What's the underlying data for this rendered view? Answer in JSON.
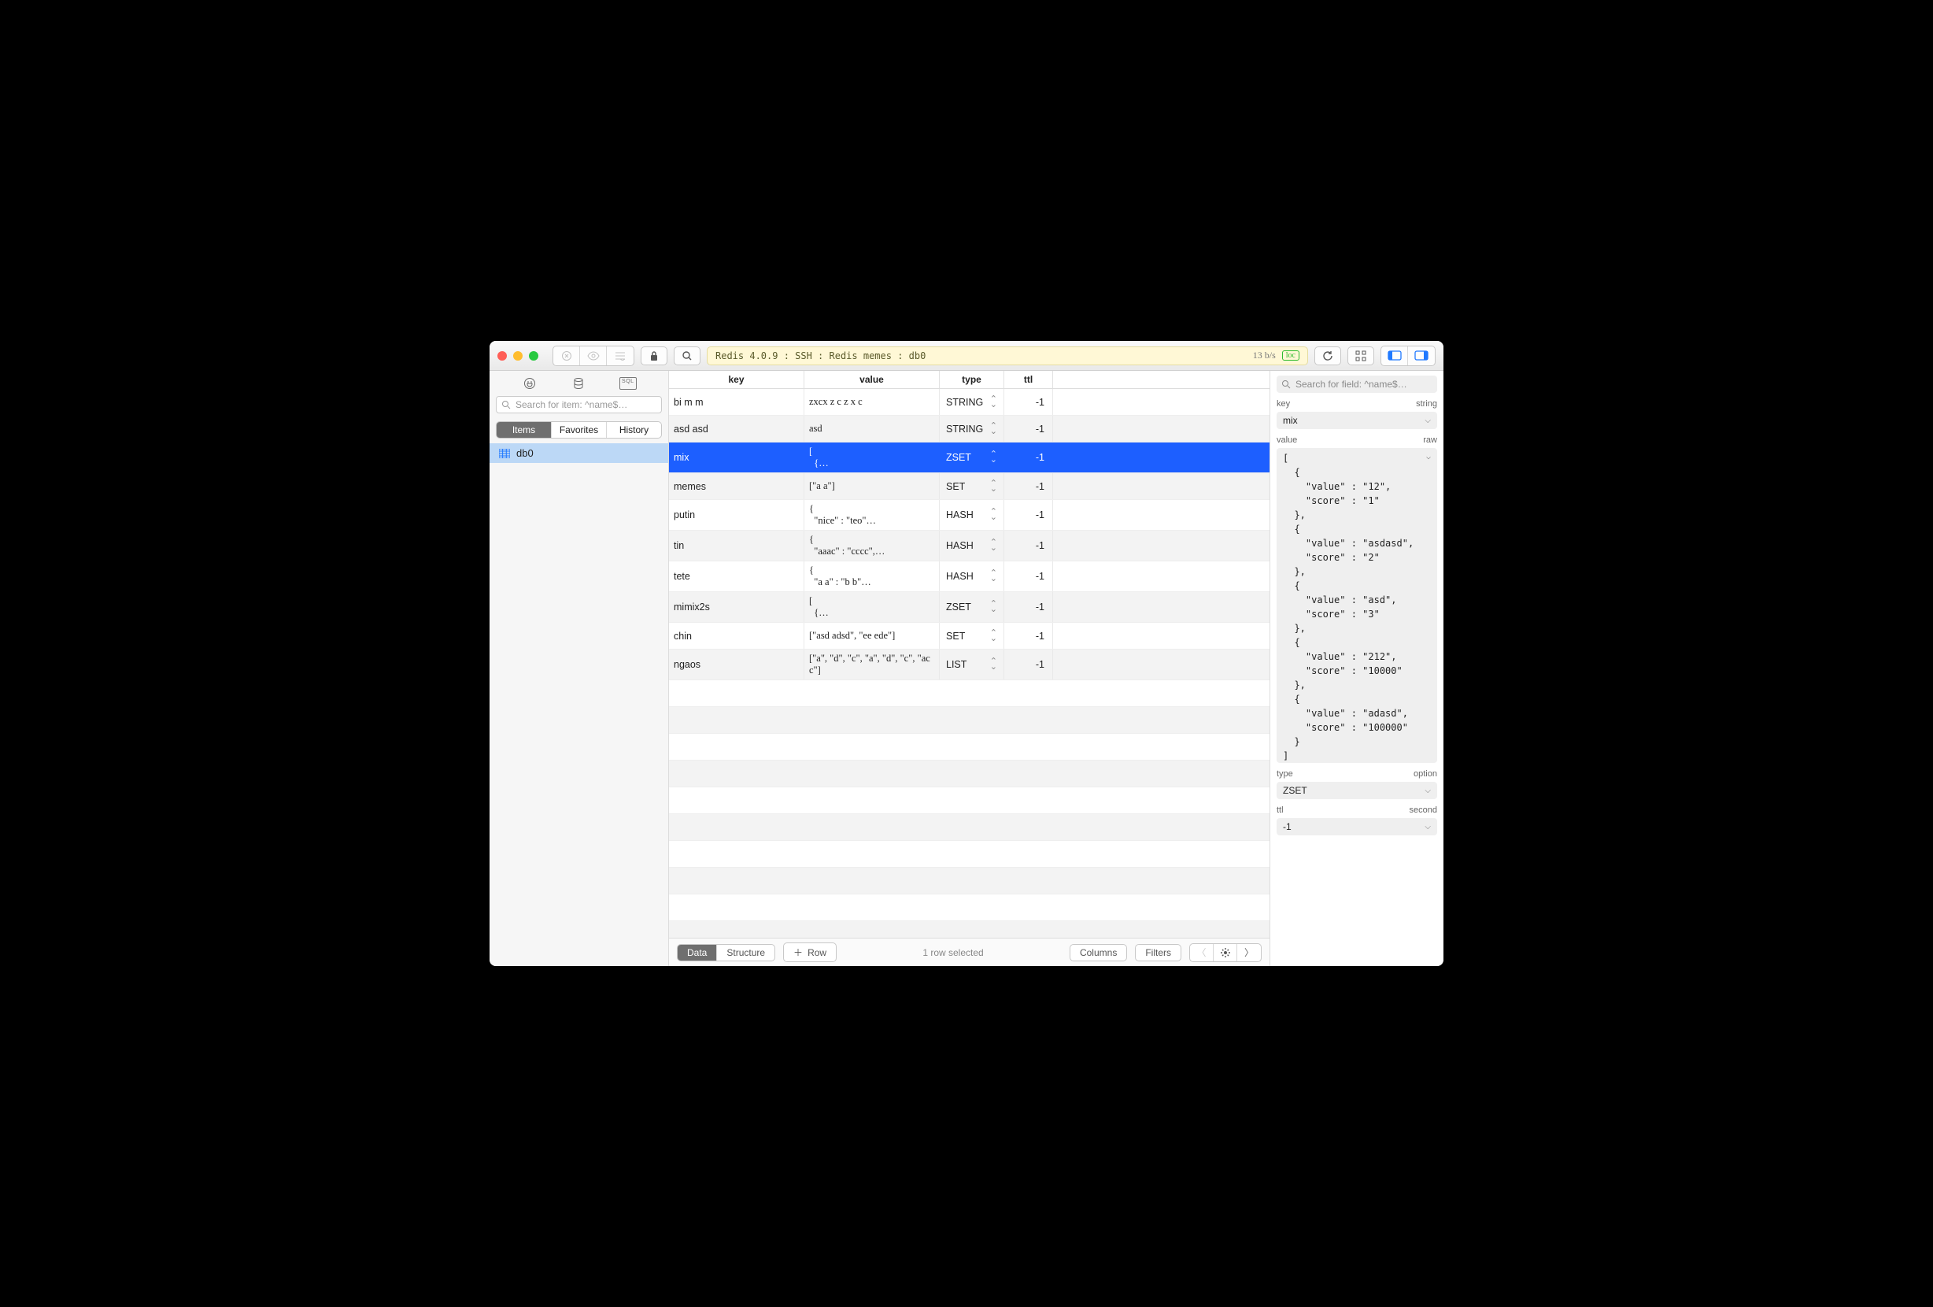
{
  "titlebar": {
    "breadcrumb": "Redis 4.0.9 : SSH : Redis memes : db0",
    "throughput": "13 b/s",
    "loc_badge": "loc"
  },
  "sidebar": {
    "search_placeholder": "Search for item: ^name$…",
    "tabs": {
      "items": "Items",
      "favorites": "Favorites",
      "history": "History"
    },
    "db_item": "db0"
  },
  "table": {
    "headers": {
      "key": "key",
      "value": "value",
      "type": "type",
      "ttl": "ttl"
    },
    "rows": [
      {
        "key": "bi m m",
        "value": "zxcx z c z x c",
        "type": "STRING",
        "ttl": "-1",
        "selected": false
      },
      {
        "key": "asd asd",
        "value": "asd",
        "type": "STRING",
        "ttl": "-1",
        "selected": false
      },
      {
        "key": "mix",
        "value": "[\n  {…",
        "type": "ZSET",
        "ttl": "-1",
        "selected": true
      },
      {
        "key": "memes",
        "value": "[\"a a\"]",
        "type": "SET",
        "ttl": "-1",
        "selected": false
      },
      {
        "key": "putin",
        "value": "{\n  \"nice\" : \"teo\"…",
        "type": "HASH",
        "ttl": "-1",
        "selected": false
      },
      {
        "key": "tin",
        "value": "{\n  \"aaac\" : \"cccc\",…",
        "type": "HASH",
        "ttl": "-1",
        "selected": false
      },
      {
        "key": "tete",
        "value": "{\n  \"a a\" : \"b b\"…",
        "type": "HASH",
        "ttl": "-1",
        "selected": false
      },
      {
        "key": "mimix2s",
        "value": "[\n  {…",
        "type": "ZSET",
        "ttl": "-1",
        "selected": false
      },
      {
        "key": "chin",
        "value": "[\"asd adsd\", \"ee ede\"]",
        "type": "SET",
        "ttl": "-1",
        "selected": false
      },
      {
        "key": "ngaos",
        "value": "[\"a\", \"d\", \"c\", \"a\", \"d\", \"c\", \"ac c\"]",
        "type": "LIST",
        "ttl": "-1",
        "selected": false
      }
    ]
  },
  "footer": {
    "seg": {
      "data": "Data",
      "structure": "Structure"
    },
    "add_row": "Row",
    "status": "1 row selected",
    "columns": "Columns",
    "filters": "Filters"
  },
  "inspector": {
    "search_placeholder": "Search for field: ^name$…",
    "labels": {
      "key": "key",
      "key_type": "string",
      "value": "value",
      "value_fmt": "raw",
      "type": "type",
      "type_opt": "option",
      "ttl": "ttl",
      "ttl_unit": "second"
    },
    "key": "mix",
    "value_text": "[\n  {\n    \"value\" : \"12\",\n    \"score\" : \"1\"\n  },\n  {\n    \"value\" : \"asdasd\",\n    \"score\" : \"2\"\n  },\n  {\n    \"value\" : \"asd\",\n    \"score\" : \"3\"\n  },\n  {\n    \"value\" : \"212\",\n    \"score\" : \"10000\"\n  },\n  {\n    \"value\" : \"adasd\",\n    \"score\" : \"100000\"\n  }\n]",
    "type": "ZSET",
    "ttl": "-1"
  }
}
